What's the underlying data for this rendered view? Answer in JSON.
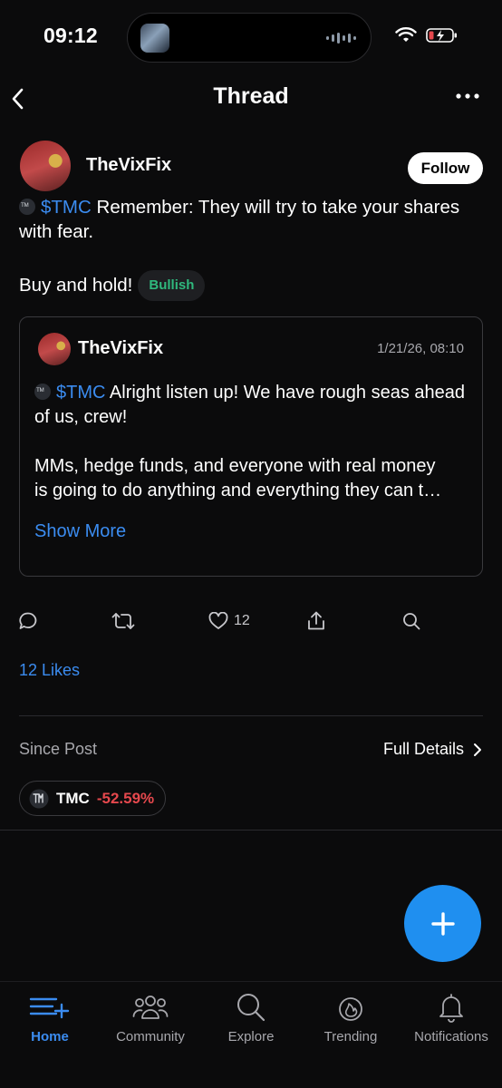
{
  "status_bar": {
    "time": "09:12"
  },
  "header": {
    "title": "Thread"
  },
  "post": {
    "author": "TheVixFix",
    "follow_label": "Follow",
    "cashtag": "$TMC",
    "text": " Remember: They will try to take your shares with fear.",
    "text2": "Buy and hold!",
    "sentiment": "Bullish"
  },
  "quote": {
    "author": "TheVixFix",
    "date": "1/21/26, 08:10",
    "cashtag": "$TMC",
    "line1": " Alright listen up! We have rough seas ahead of us, crew!",
    "line2a": "MMs, hedge funds, and everyone with real money",
    "line2b": "is going to do anything and everything they can t…",
    "show_more": "Show More"
  },
  "actions": {
    "like_count": "12"
  },
  "likes_label": "12 Likes",
  "since_post": {
    "label": "Since Post",
    "details_label": "Full Details",
    "ticker": "TMC",
    "change": "-52.59%"
  },
  "tabs": [
    {
      "label": "Home",
      "icon": "home-icon",
      "active": true
    },
    {
      "label": "Community",
      "icon": "community-icon",
      "active": false
    },
    {
      "label": "Explore",
      "icon": "explore-icon",
      "active": false
    },
    {
      "label": "Trending",
      "icon": "trending-icon",
      "active": false
    },
    {
      "label": "Notifications",
      "icon": "bell-icon",
      "active": false
    }
  ],
  "colors": {
    "accent": "#3b8cf0",
    "bullish": "#2fb87d",
    "negative": "#e5484d",
    "fab": "#1f8ff0"
  }
}
